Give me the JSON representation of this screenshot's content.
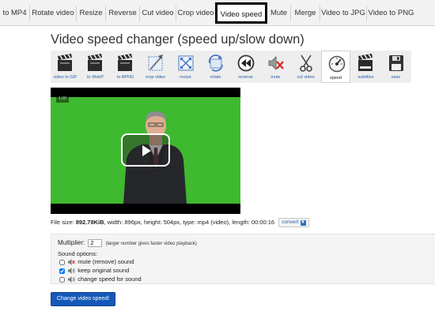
{
  "tabs": [
    {
      "label": "to MP4",
      "active": false
    },
    {
      "label": "Rotate video",
      "active": false
    },
    {
      "label": "Resize",
      "active": false
    },
    {
      "label": "Reverse",
      "active": false
    },
    {
      "label": "Cut video",
      "active": false
    },
    {
      "label": "Crop video",
      "active": false
    },
    {
      "label": "Video speed",
      "active": true
    },
    {
      "label": "Mute",
      "active": false
    },
    {
      "label": "Merge",
      "active": false
    },
    {
      "label": "Video to JPG",
      "active": false
    },
    {
      "label": "Video to PNG",
      "active": false
    }
  ],
  "page_title": "Video speed changer (speed up/slow down)",
  "tools": [
    {
      "label": "video to GIF",
      "icon": "clapper-icon"
    },
    {
      "label": "to WebP",
      "icon": "clapper-icon"
    },
    {
      "label": "to APNG",
      "icon": "clapper-icon"
    },
    {
      "label": "crop video",
      "icon": "crop-icon"
    },
    {
      "label": "resize",
      "icon": "resize-icon"
    },
    {
      "label": "rotate",
      "icon": "rotate-icon"
    },
    {
      "label": "reverse",
      "icon": "rewind-icon"
    },
    {
      "label": "mute",
      "icon": "mute-icon"
    },
    {
      "label": "cut video",
      "icon": "scissors-icon"
    },
    {
      "label": "speed",
      "icon": "speedometer-icon",
      "active": true
    },
    {
      "label": "subtitles",
      "icon": "clapper-icon"
    },
    {
      "label": "save",
      "icon": "floppy-icon"
    }
  ],
  "video": {
    "time_tag": "1:00",
    "screen_color": "#3fb92f"
  },
  "file_info": {
    "prefix": "File size: ",
    "size": "892.78KiB",
    "details": ", width: 896px, height: 504px, type: mp4 (video), length: 00:00:16",
    "convert_label": "convert"
  },
  "options": {
    "multiplier_label": "Multiplier:",
    "multiplier_value": "2",
    "multiplier_hint": "(larger number gives faster video playback)",
    "sound_label": "Sound options:",
    "sound_options": [
      {
        "label": "mute (remove) sound",
        "checked": false,
        "icon": "speaker-muted-icon"
      },
      {
        "label": "keep original sound",
        "checked": true,
        "icon": "speaker-icon"
      },
      {
        "label": "change speed for sound",
        "checked": false,
        "icon": "speaker-icon"
      }
    ]
  },
  "submit_label": "Change video speed!",
  "colors": {
    "accent": "#1559b9",
    "link": "#2a5fa8",
    "tab_bar": "#f2f2f2"
  }
}
